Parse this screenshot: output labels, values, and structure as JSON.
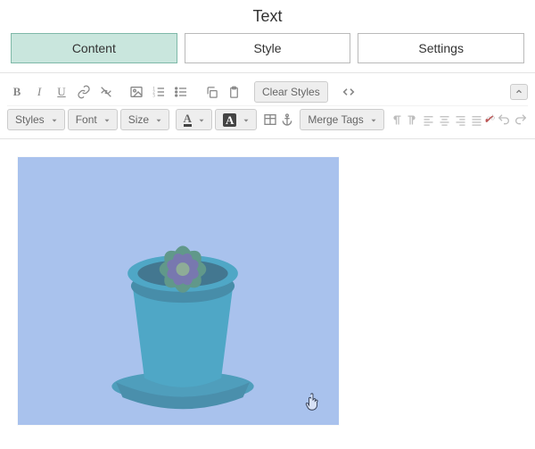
{
  "header": {
    "title": "Text"
  },
  "tabs": [
    {
      "label": "Content",
      "active": true
    },
    {
      "label": "Style",
      "active": false
    },
    {
      "label": "Settings",
      "active": false
    }
  ],
  "toolbar": {
    "row1": {
      "clear_styles_label": "Clear Styles"
    },
    "row2": {
      "styles_label": "Styles",
      "font_label": "Font",
      "size_label": "Size",
      "merge_tags_label": "Merge Tags"
    }
  },
  "icons": {
    "row1": [
      "bold",
      "italic",
      "underline",
      "link",
      "unlink",
      "image",
      "ordered-list",
      "unordered-list",
      "copy",
      "paste",
      "clear-styles",
      "code"
    ],
    "row2_dropdowns": [
      "styles",
      "font",
      "size",
      "text-color",
      "highlight-color",
      "insert-table",
      "anchor",
      "merge-tags"
    ],
    "row2_tail": [
      "paragraph-ltr",
      "paragraph-rtl",
      "align-left",
      "align-center",
      "align-right",
      "align-justify",
      "strikethrough",
      "undo",
      "redo"
    ]
  },
  "canvas": {
    "image_alt": "selected image of a teal flowerpot with a green and purple succulent on a light blue background",
    "overlay_color": "#8caae659"
  }
}
